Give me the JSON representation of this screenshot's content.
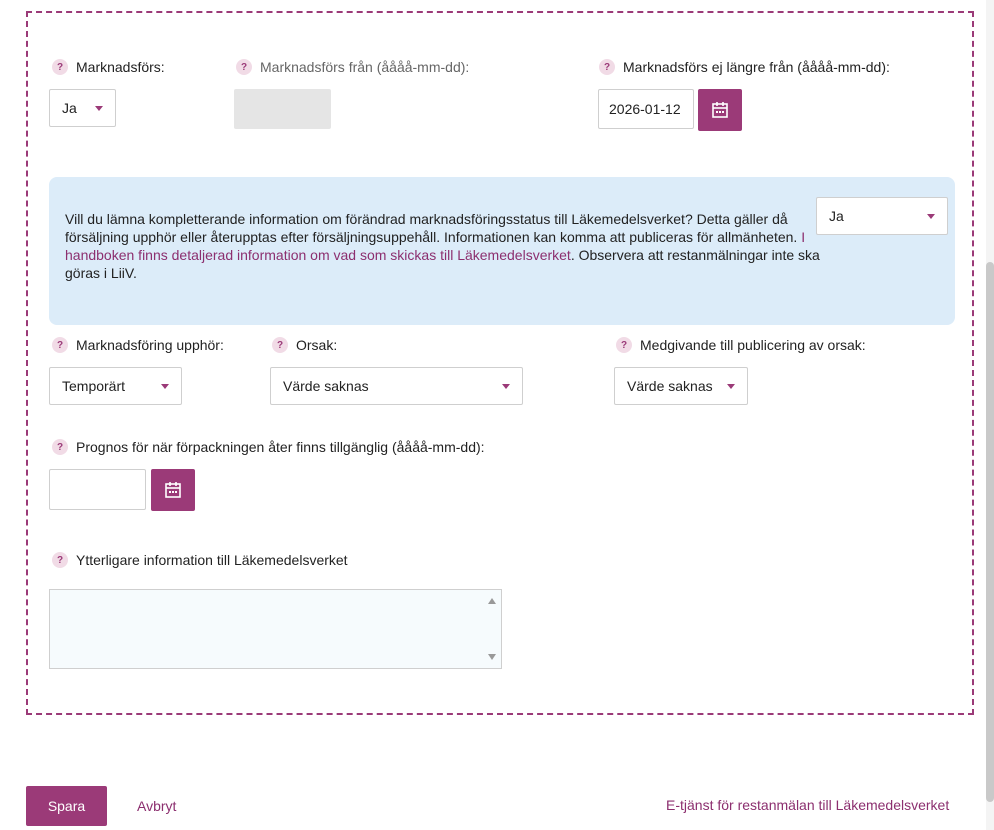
{
  "help_glyph": "?",
  "fields": {
    "marknadsfors": {
      "label": "Marknadsförs:",
      "value": "Ja"
    },
    "marknadsfors_fran": {
      "label": "Marknadsförs från (åååå-mm-dd):",
      "value": ""
    },
    "marknadsfors_ej_langre": {
      "label": "Marknadsförs ej längre från (åååå-mm-dd):",
      "value": "2026-01-12"
    }
  },
  "info": {
    "text_before": "Vill du lämna kompletterande information om förändrad marknadsföringsstatus till Läkemedelsverket? Detta gäller då försäljning upphör eller återupptas efter försäljningsuppehåll. Informationen kan komma att publiceras för allmänheten. ",
    "link": "I handboken finns detaljerad information om vad som skickas till Läkemedelsverket",
    "text_after": ". Observera att restanmälningar inte ska göras i LiiV.",
    "select_value": "Ja"
  },
  "upphor": {
    "label": "Marknadsföring upphör:",
    "value": "Temporärt"
  },
  "orsak": {
    "label": "Orsak:",
    "value": "Värde saknas"
  },
  "medgivande": {
    "label": "Medgivande till publicering av orsak:",
    "value": "Värde saknas"
  },
  "prognos": {
    "label": "Prognos för när förpackningen åter finns tillgänglig (åååå-mm-dd):",
    "value": ""
  },
  "ytterligare": {
    "label": "Ytterligare information till Läkemedelsverket",
    "value": ""
  },
  "footer": {
    "save_label": "Spara",
    "cancel_label": "Avbryt",
    "etjanst_link": "E-tjänst för restanmälan till Läkemedelsverket"
  },
  "icons": {
    "help": "question-mark-icon",
    "calendar": "calendar-icon",
    "caret": "chevron-down-icon"
  },
  "colors": {
    "accent": "#9b3a78",
    "info_bg": "#dcecf9",
    "disabled": "#e5e5e5"
  }
}
